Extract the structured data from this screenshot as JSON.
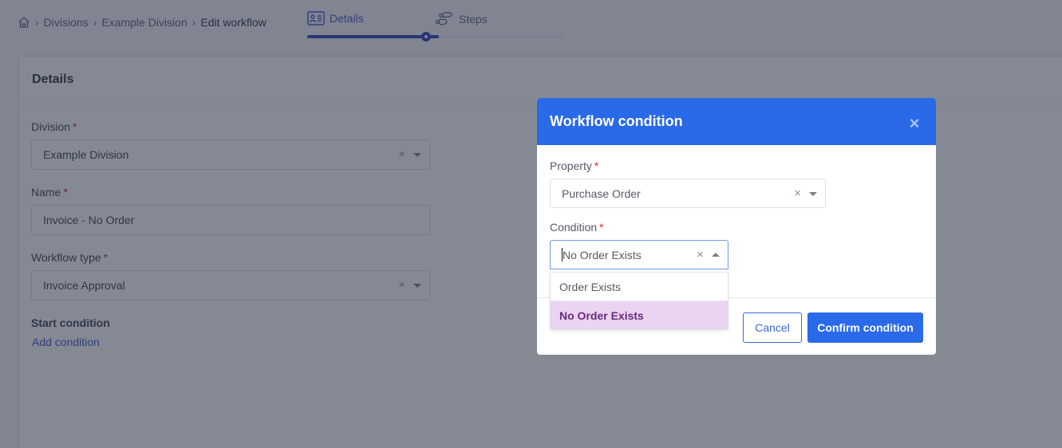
{
  "breadcrumb": {
    "home_icon": "home-icon",
    "items": [
      "Divisions",
      "Example Division"
    ],
    "current": "Edit workflow",
    "separator": ">"
  },
  "stepper": {
    "steps": [
      {
        "label": "Details",
        "icon": "id-card-icon",
        "active": true
      },
      {
        "label": "Steps",
        "icon": "footprints-icon",
        "active": false
      }
    ],
    "progress": 0.5
  },
  "panel": {
    "title": "Details",
    "fields": {
      "division": {
        "label": "Division",
        "required": "*",
        "value": "Example Division"
      },
      "name": {
        "label": "Name",
        "required": "*",
        "value": "Invoice - No Order"
      },
      "workflow_type": {
        "label": "Workflow type",
        "required": "*",
        "value": "Invoice Approval"
      }
    },
    "start_condition": {
      "label": "Start condition",
      "link": "Add condition"
    }
  },
  "modal": {
    "title": "Workflow condition",
    "close_icon": "×",
    "property": {
      "label": "Property",
      "required": "*",
      "value": "Purchase Order"
    },
    "condition": {
      "label": "Condition",
      "required": "*",
      "value": "No Order Exists",
      "options": [
        {
          "label": "Order Exists",
          "selected": false
        },
        {
          "label": "No Order Exists",
          "selected": true
        }
      ]
    },
    "cancel_label": "Cancel",
    "confirm_label": "Confirm condition"
  },
  "icons": {
    "clear": "×"
  },
  "colors": {
    "accent": "#2a6ae8",
    "stepper_active": "#2541b2",
    "selected_option_bg": "#ead4f0",
    "selected_option_text": "#6a2a7e",
    "required": "#d42a2a"
  }
}
